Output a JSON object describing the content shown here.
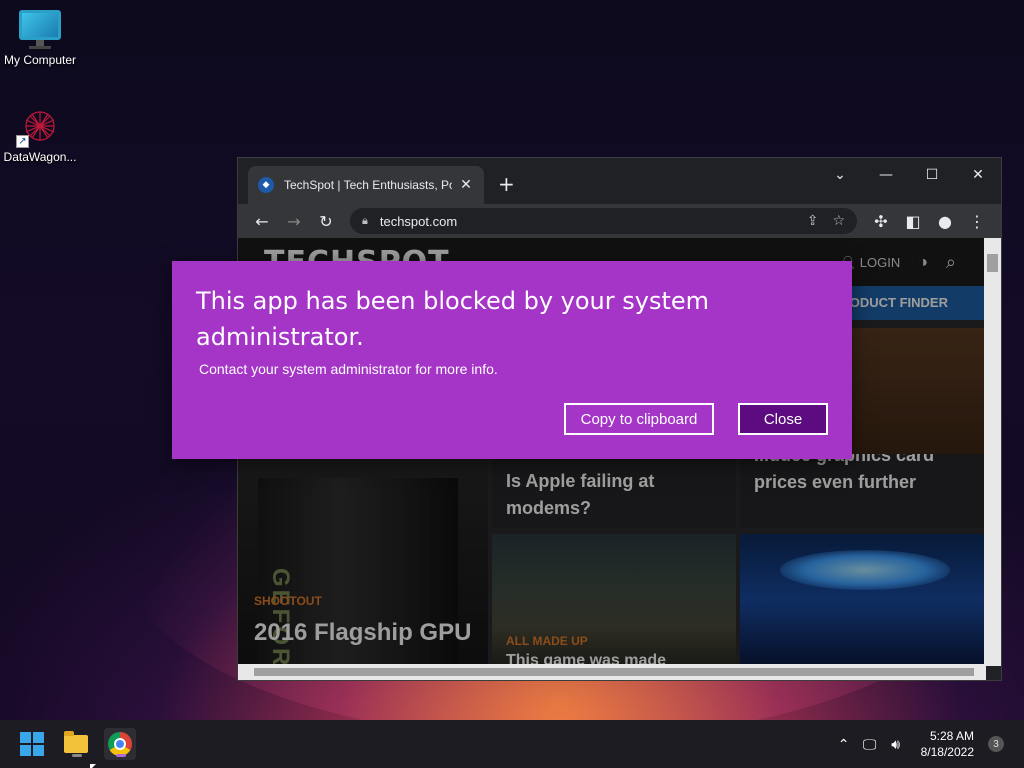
{
  "desktop": {
    "icons": [
      {
        "label": "My Computer",
        "icon": "monitor-icon"
      },
      {
        "label": "DataWagon...",
        "icon": "datawagon-app-icon"
      }
    ]
  },
  "browser": {
    "tab_title": "TechSpot | Tech Enthusiasts, Pow",
    "new_tab_symbol": "+",
    "url": "techspot.com",
    "window_controls": {
      "chevron": "⌄",
      "minimize": "—",
      "maximize": "☐",
      "close": "✕"
    },
    "toolbar": {
      "back": "←",
      "forward": "→",
      "reload": "↻"
    }
  },
  "site": {
    "logo": "TECHSPOT",
    "login": "LOGIN",
    "product_finder": "PRODUCT FINDER",
    "cards": [
      {
        "kicker": "SHOOTOUT",
        "headline": "2016 Flagship GPU"
      },
      {
        "kicker": "",
        "headline": "Is Apple failing at modems?"
      },
      {
        "kicker": "",
        "headline": "...duce graphics card prices even further"
      },
      {
        "kicker": "ALL MADE UP",
        "headline": "This game was made"
      },
      {
        "kicker": "",
        "headline": ""
      }
    ],
    "gpu_text": "GEFORCE"
  },
  "dialog": {
    "title": "This app has been blocked by your system administrator.",
    "message": "Contact your system administrator for more info.",
    "copy_button": "Copy to clipboard",
    "close_button": "Close",
    "accent_color": "#a435c6"
  },
  "taskbar": {
    "time": "5:28 AM",
    "date": "8/18/2022",
    "notification_count": "3",
    "tray_icons": [
      "chevron-up-icon",
      "network-icon",
      "volume-icon"
    ]
  }
}
